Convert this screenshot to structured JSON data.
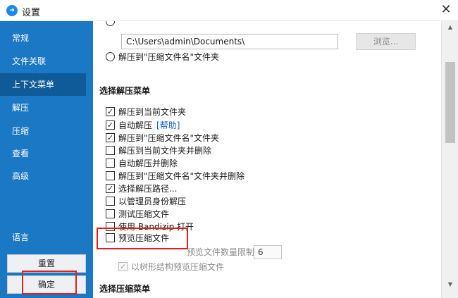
{
  "window": {
    "title": "设置",
    "close_glyph": "✕"
  },
  "sidebar": {
    "items": [
      {
        "label": "常规"
      },
      {
        "label": "文件关联"
      },
      {
        "label": "上下文菜单",
        "active": true
      },
      {
        "label": "解压"
      },
      {
        "label": "压缩"
      },
      {
        "label": "查看"
      },
      {
        "label": "高级"
      },
      {
        "label": "语言"
      }
    ],
    "reset_label": "重置",
    "ok_label": "确定"
  },
  "content": {
    "path_value": "C:\\Users\\admin\\Documents\\",
    "browse_label": "浏览...",
    "radio_archive_folder": "解压到\"压缩文件名\"文件夹",
    "section_extract_title": "选择解压菜单",
    "extract_menu": [
      {
        "label": "解压到当前文件夹",
        "checked": true
      },
      {
        "label": "自动解压",
        "checked": true,
        "link": "[帮助]"
      },
      {
        "label": "解压到\"压缩文件名\"文件夹",
        "checked": true
      },
      {
        "label": "解压到当前文件夹并删除",
        "checked": false
      },
      {
        "label": "自动解压并删除",
        "checked": false
      },
      {
        "label": "解压到\"压缩文件名\"文件夹并删除",
        "checked": false
      },
      {
        "label": "选择解压路径...",
        "checked": true
      },
      {
        "label": "以管理员身份解压",
        "checked": false
      },
      {
        "label": "测试压缩文件",
        "checked": false
      },
      {
        "label": "使用 Bandizip 打开",
        "checked": false
      },
      {
        "label": "预览压缩文件",
        "checked": false
      }
    ],
    "preview_limit_label": "预览文件数量限制:",
    "preview_limit_value": "6",
    "tree_preview_label": "以树形结构预览压缩文件",
    "section_compress_title": "选择压缩菜单"
  },
  "colors": {
    "sidebar": "#1b78c4",
    "sidebar_active": "#0f5a98",
    "highlight": "#e02020",
    "link": "#1a5fd6"
  },
  "icons": {
    "app": "bandizip-app-icon",
    "close": "close-icon",
    "scroll_up": "scroll-up-icon",
    "scroll_down": "scroll-down-icon"
  }
}
